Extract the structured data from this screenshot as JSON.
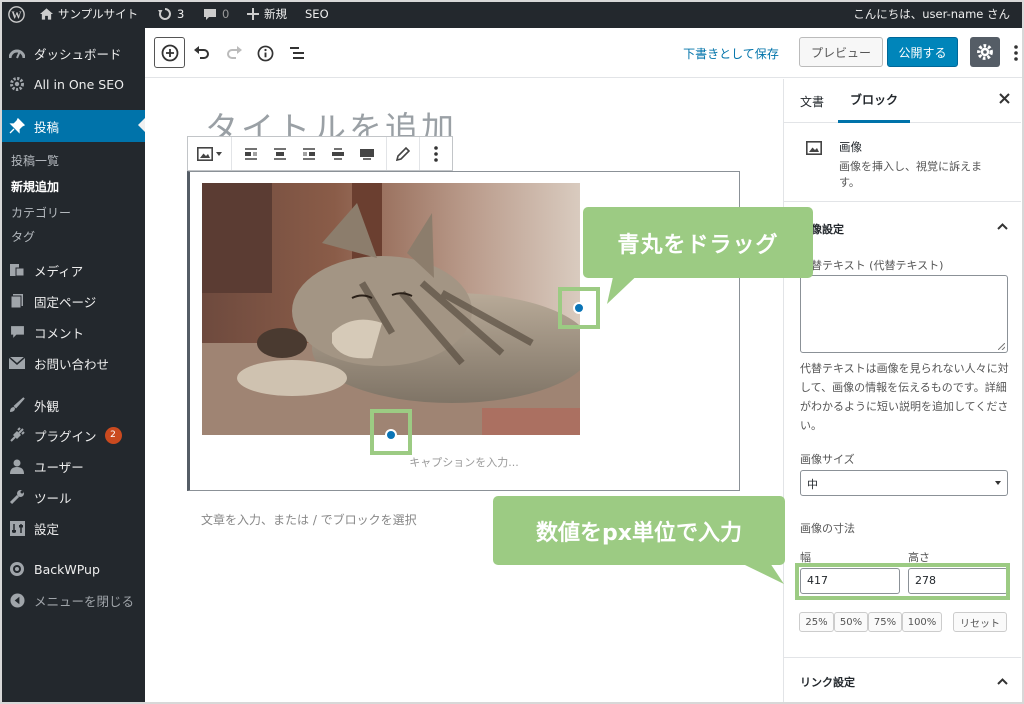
{
  "adminbar": {
    "site_name": "サンプルサイト",
    "updates_count": "3",
    "comments_count": "0",
    "new_label": "新規",
    "seo_label": "SEO",
    "greeting": "こんにちは、user-name さん"
  },
  "sidebar": {
    "items": [
      {
        "label": "ダッシュボード",
        "icon": "dashboard-icon"
      },
      {
        "label": "All in One SEO",
        "icon": "gear-icon"
      },
      {
        "label": "投稿",
        "icon": "pin-icon"
      },
      {
        "label": "メディア",
        "icon": "media-icon"
      },
      {
        "label": "固定ページ",
        "icon": "pages-icon"
      },
      {
        "label": "コメント",
        "icon": "comment-icon"
      },
      {
        "label": "お問い合わせ",
        "icon": "mail-icon"
      },
      {
        "label": "外観",
        "icon": "brush-icon"
      },
      {
        "label": "プラグイン",
        "icon": "plugin-icon",
        "badge": "2"
      },
      {
        "label": "ユーザー",
        "icon": "user-icon"
      },
      {
        "label": "ツール",
        "icon": "wrench-icon"
      },
      {
        "label": "設定",
        "icon": "settings-icon"
      },
      {
        "label": "BackWPup",
        "icon": "backwpup-icon"
      },
      {
        "label": "メニューを閉じる",
        "icon": "collapse-icon"
      }
    ],
    "submenu": [
      "投稿一覧",
      "新規追加",
      "カテゴリー",
      "タグ"
    ]
  },
  "toolbar": {
    "save_draft": "下書きとして保存",
    "preview": "プレビュー",
    "publish": "公開する"
  },
  "editor": {
    "title_placeholder": "タイトルを追加",
    "caption_placeholder": "キャプションを入力...",
    "body_placeholder": "文章を入力、または / でブロックを選択"
  },
  "panel": {
    "tabs": [
      "文書",
      "ブロック"
    ],
    "block_name": "画像",
    "block_desc": "画像を挿入し、視覚に訴えます。",
    "image_settings": "画像設定",
    "alt_label": "代替テキスト (代替テキスト)",
    "alt_help": "代替テキストは画像を見られない人々に対して、画像の情報を伝えるものです。詳細がわかるように短い説明を追加してください。",
    "size_label": "画像サイズ",
    "size_value": "中",
    "dimensions_label": "画像の寸法",
    "width_label": "幅",
    "height_label": "高さ",
    "width_value": "417",
    "height_value": "278",
    "percent_buttons": [
      "25%",
      "50%",
      "75%",
      "100%"
    ],
    "reset": "リセット",
    "link_settings": "リンク設定"
  },
  "annotations": {
    "drag": "青丸をドラッグ",
    "px": "数値をpx単位で入力"
  },
  "colors": {
    "admin_dark": "#23282d",
    "accent": "#0073aa",
    "annotation_green": "#9ccb83"
  }
}
